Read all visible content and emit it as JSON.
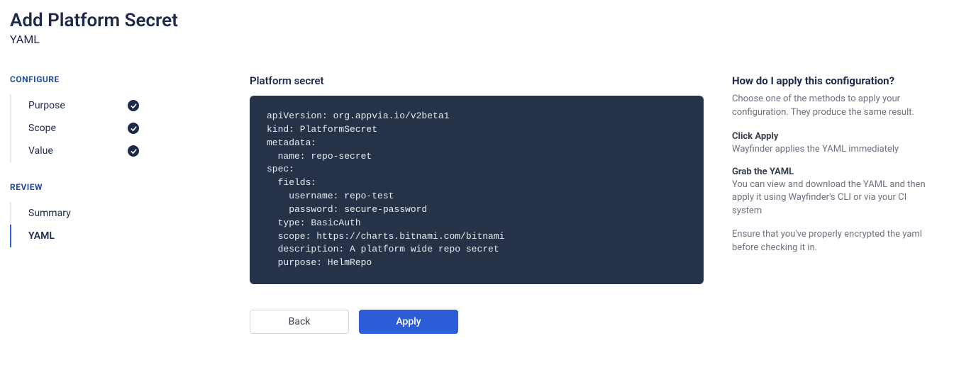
{
  "header": {
    "title": "Add Platform Secret",
    "subtitle": "YAML"
  },
  "sidebar": {
    "configure": {
      "label": "CONFIGURE",
      "items": [
        {
          "label": "Purpose",
          "checked": true
        },
        {
          "label": "Scope",
          "checked": true
        },
        {
          "label": "Value",
          "checked": true
        }
      ]
    },
    "review": {
      "label": "REVIEW",
      "items": [
        {
          "label": "Summary",
          "active": false
        },
        {
          "label": "YAML",
          "active": true
        }
      ]
    }
  },
  "main": {
    "title": "Platform secret",
    "yaml": "apiVersion: org.appvia.io/v2beta1\nkind: PlatformSecret\nmetadata:\n  name: repo-secret\nspec:\n  fields:\n    username: repo-test\n    password: secure-password\n  type: BasicAuth\n  scope: https://charts.bitnami.com/bitnami\n  description: A platform wide repo secret\n  purpose: HelmRepo",
    "buttons": {
      "back": "Back",
      "apply": "Apply"
    }
  },
  "help": {
    "title": "How do I apply this configuration?",
    "intro": "Choose one of the methods to apply your configuration. They produce the same result.",
    "blocks": [
      {
        "title": "Click Apply",
        "text": "Wayfinder applies the YAML immediately"
      },
      {
        "title": "Grab the YAML",
        "text": "You can view and download the YAML and then apply it using Wayfinder's CLI or via your CI system"
      }
    ],
    "footer": "Ensure that you've properly encrypted the yaml before checking it in."
  }
}
